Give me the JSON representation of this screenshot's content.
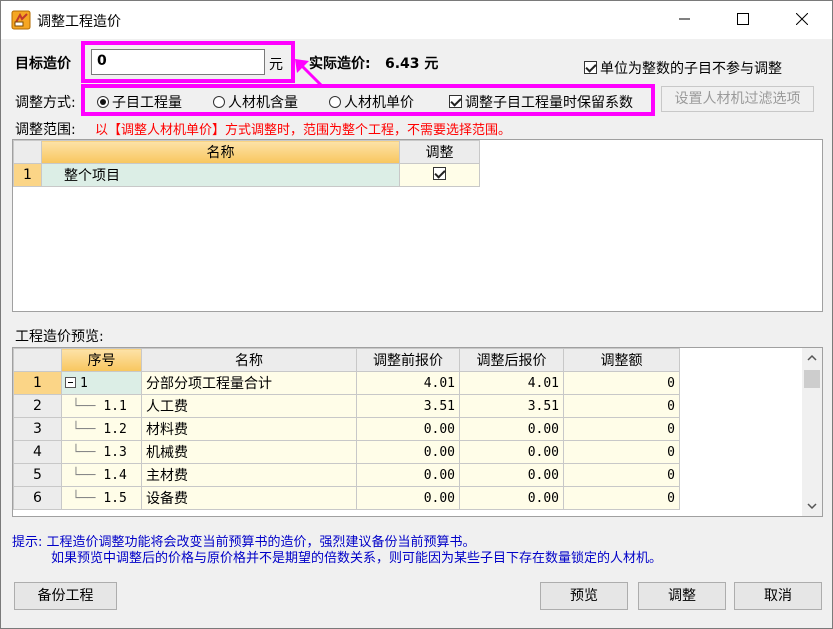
{
  "window": {
    "title": "调整工程造价",
    "minimize": "—",
    "maximize": "☐",
    "close": "✕"
  },
  "target": {
    "label": "目标造价",
    "value": "0",
    "unit": "元",
    "actual_label": "实际造价:",
    "actual_value": "6.43 元"
  },
  "integer_option": {
    "label": "单位为整数的子目不参与调整",
    "checked": true
  },
  "method": {
    "label": "调整方式:",
    "options": [
      {
        "label": "子目工程量",
        "selected": true
      },
      {
        "label": "人材机含量",
        "selected": false
      },
      {
        "label": "人材机单价",
        "selected": false
      }
    ],
    "keep_coef": {
      "label": "调整子目工程量时保留系数",
      "checked": true
    },
    "filter_button": "设置人材机过滤选项"
  },
  "scope": {
    "label": "调整范围:",
    "note": "以【调整人材机单价】方式调整时，范围为整个工程，不需要选择范围。",
    "headers": [
      "名称",
      "调整"
    ],
    "rows": [
      {
        "num": "1",
        "name": "整个项目",
        "adjust": true
      }
    ]
  },
  "preview": {
    "label": "工程造价预览:",
    "headers": [
      "序号",
      "名称",
      "调整前报价",
      "调整后报价",
      "调整额"
    ],
    "rows": [
      {
        "num": "1",
        "seq": "1",
        "name": "分部分项工程量合计",
        "before": "4.01",
        "after": "4.01",
        "diff": "0"
      },
      {
        "num": "2",
        "seq": "1.1",
        "name": "人工费",
        "before": "3.51",
        "after": "3.51",
        "diff": "0"
      },
      {
        "num": "3",
        "seq": "1.2",
        "name": "材料费",
        "before": "0.00",
        "after": "0.00",
        "diff": "0"
      },
      {
        "num": "4",
        "seq": "1.3",
        "name": "机械费",
        "before": "0.00",
        "after": "0.00",
        "diff": "0"
      },
      {
        "num": "5",
        "seq": "1.4",
        "name": "主材费",
        "before": "0.00",
        "after": "0.00",
        "diff": "0"
      },
      {
        "num": "6",
        "seq": "1.5",
        "name": "设备费",
        "before": "0.00",
        "after": "0.00",
        "diff": "0"
      }
    ]
  },
  "tip": {
    "line1": "提示: 工程造价调整功能将会改变当前预算书的造价，强烈建议备份当前预算书。",
    "line2": "如果预览中调整后的价格与原价格并不是期望的倍数关系，则可能因为某些子目下存在数量锁定的人材机。"
  },
  "buttons": {
    "backup": "备份工程",
    "preview": "预览",
    "adjust": "调整",
    "cancel": "取消"
  },
  "colors": {
    "annotation": "#ff00ff",
    "warning": "#ff0000",
    "header": "#f8c65e"
  }
}
